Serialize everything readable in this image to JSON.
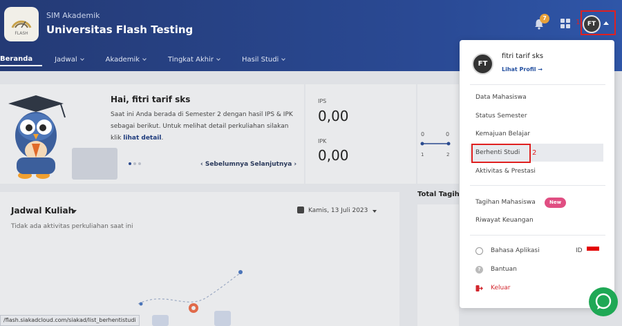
{
  "header": {
    "app_sub": "SIM Akademik",
    "app_title": "Universitas Flash Testing",
    "logo_text": "FLASH",
    "notif_count": "7",
    "user_initials": "FT",
    "annotation_1": "1"
  },
  "nav": {
    "items": [
      {
        "label": "Beranda"
      },
      {
        "label": "Jadwal"
      },
      {
        "label": "Akademik"
      },
      {
        "label": "Tingkat Akhir"
      },
      {
        "label": "Hasil Studi"
      }
    ]
  },
  "welcome": {
    "greeting": "Hai, fitri tarif sks",
    "desc_prefix": "Saat ini Anda berada di Semester 2 dengan hasil IPS & IPK sebagai berikut. Untuk melihat detail perkuliahan silakan klik ",
    "desc_link": "lihat detail",
    "desc_suffix": ".",
    "prev_label": "‹ Sebelumnya",
    "next_label": "Selanjutnya ›"
  },
  "stats": {
    "ips_label": "IPS",
    "ips_value": "0,00",
    "ipk_label": "IPK",
    "ipk_value": "0,00",
    "chart_top_0": "0",
    "chart_top_1": "0",
    "chart_x_1": "1",
    "chart_x_2": "2"
  },
  "jadwal": {
    "title": "Jadwal Kuliah",
    "date": "Kamis, 13 Juli 2023",
    "empty": "Tidak ada aktivitas perkuliahan saat ini"
  },
  "tagihan": {
    "title": "Total Tagiha"
  },
  "status_bar": {
    "url": "/flash.siakadcloud.com/siakad/list_berhentistudi"
  },
  "dropdown": {
    "user_initials": "FT",
    "name": "fitri tarif sks",
    "profile_link": "Lihat Profil →",
    "items": [
      {
        "label": "Data Mahasiswa"
      },
      {
        "label": "Status Semester"
      },
      {
        "label": "Kemajuan Belajar"
      },
      {
        "label": "Berhenti Studi"
      },
      {
        "label": "Aktivitas & Prestasi"
      },
      {
        "label": "Tagihan Mahasiswa"
      },
      {
        "label": "Riwayat Keuangan"
      },
      {
        "label": "Bahasa Aplikasi"
      },
      {
        "label": "Bantuan"
      },
      {
        "label": "Keluar"
      }
    ],
    "new_badge": "New",
    "lang_value": "ID",
    "annotation_2": "2"
  },
  "colors": {
    "header": "#243a75",
    "accent_link": "#2450a0",
    "badge_new": "#e04e82",
    "logout": "#d2262d",
    "highlight": "#e02020",
    "chat": "#1fa855"
  }
}
